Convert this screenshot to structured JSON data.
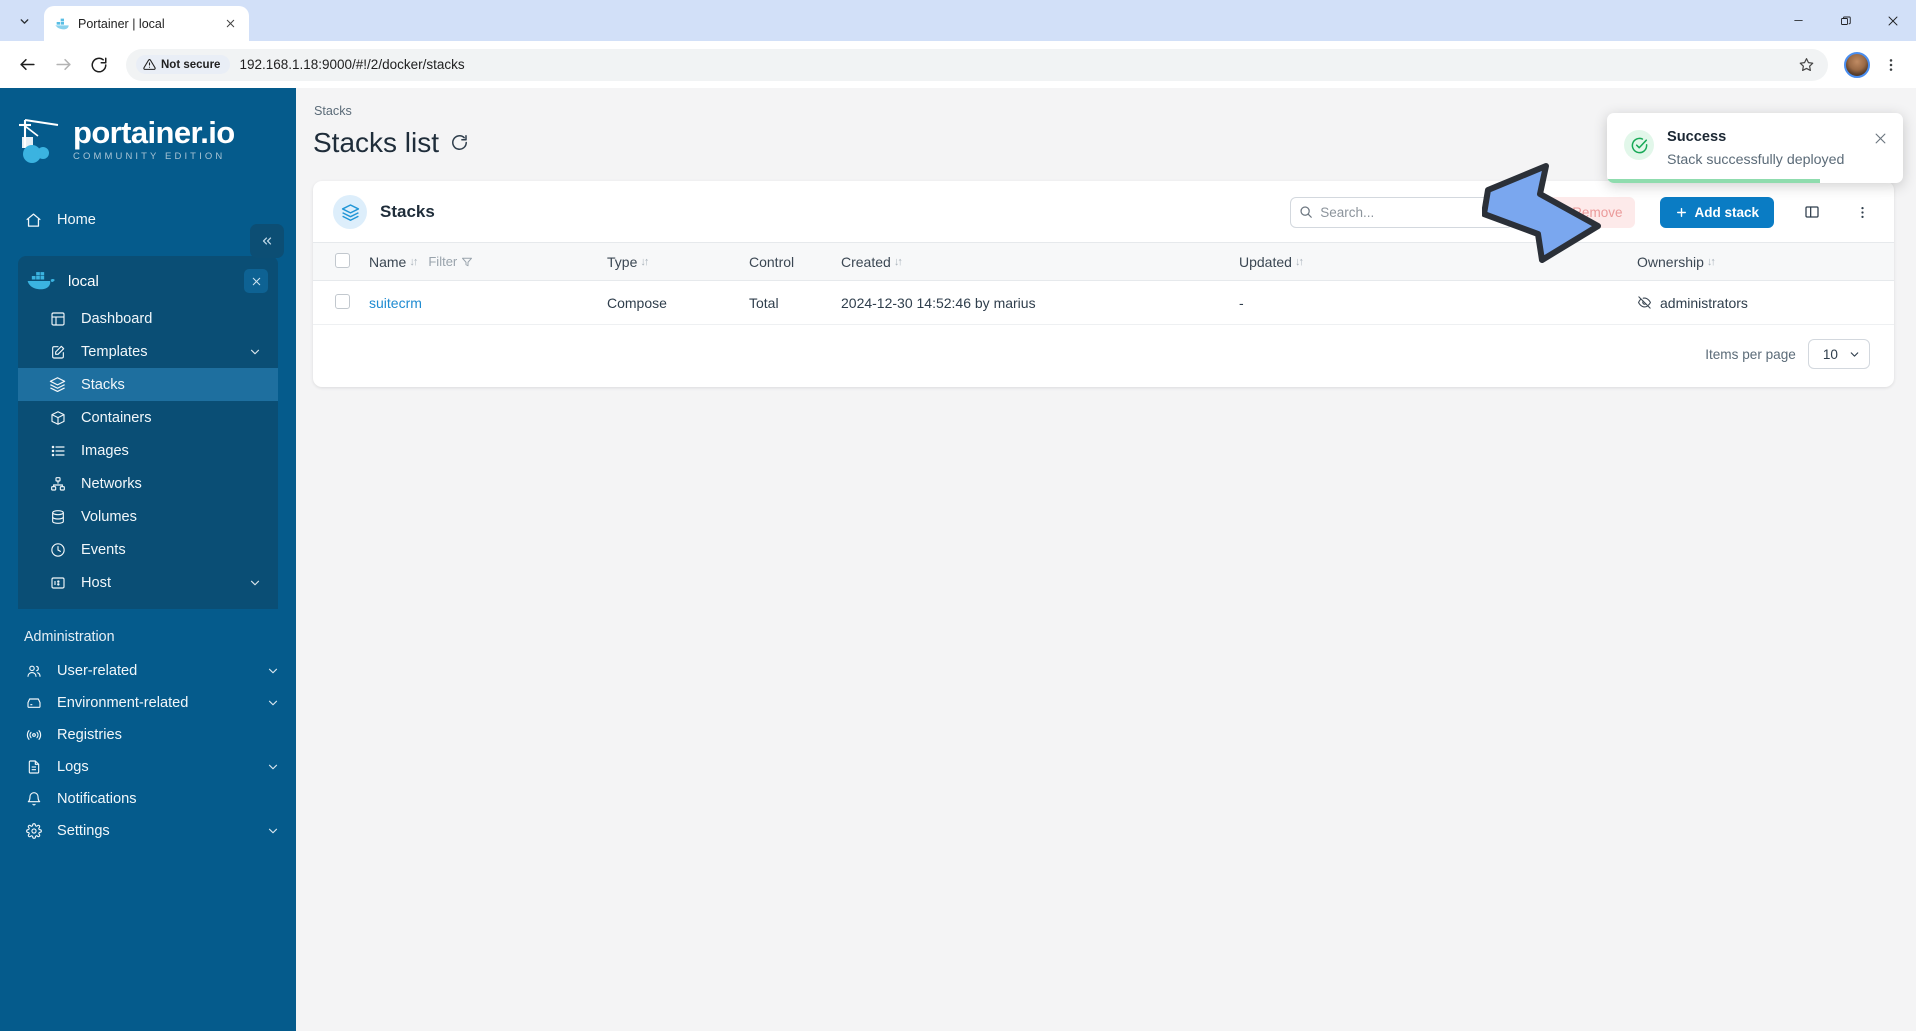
{
  "browser": {
    "tab": {
      "title": "Portainer | local",
      "favicon_icon": "portainer-favicon",
      "close_icon": "close-icon"
    },
    "tab_list_icon": "chevron-down-icon",
    "window_controls": {
      "minimize_icon": "minimize-icon",
      "maximize_icon": "restore-icon",
      "close_icon": "close-icon"
    },
    "nav": {
      "back_icon": "arrow-left-icon",
      "forward_icon": "arrow-right-icon",
      "reload_icon": "reload-icon"
    },
    "omnibox": {
      "security_icon": "warning-triangle-icon",
      "security_label": "Not secure",
      "url": "192.168.1.18:9000/#!/2/docker/stacks",
      "star_icon": "star-icon"
    },
    "profile_icon": "avatar",
    "menu_icon": "kebab-menu-icon"
  },
  "sidebar": {
    "logo": {
      "word": "portainer.io",
      "subtitle": "COMMUNITY EDITION",
      "icon": "portainer-logo-icon"
    },
    "collapse_icon": "chevron-double-left-icon",
    "home": {
      "label": "Home",
      "icon": "home-icon"
    },
    "environment": {
      "name": "local",
      "icon": "docker-whale-icon",
      "close_icon": "close-icon"
    },
    "env_items": [
      {
        "label": "Dashboard",
        "icon": "dashboard-icon",
        "active": false,
        "expandable": false
      },
      {
        "label": "Templates",
        "icon": "template-icon",
        "active": false,
        "expandable": true
      },
      {
        "label": "Stacks",
        "icon": "stacks-icon",
        "active": true,
        "expandable": false
      },
      {
        "label": "Containers",
        "icon": "container-icon",
        "active": false,
        "expandable": false
      },
      {
        "label": "Images",
        "icon": "images-icon",
        "active": false,
        "expandable": false
      },
      {
        "label": "Networks",
        "icon": "networks-icon",
        "active": false,
        "expandable": false
      },
      {
        "label": "Volumes",
        "icon": "volumes-icon",
        "active": false,
        "expandable": false
      },
      {
        "label": "Events",
        "icon": "events-clock-icon",
        "active": false,
        "expandable": false
      },
      {
        "label": "Host",
        "icon": "host-icon",
        "active": false,
        "expandable": true
      }
    ],
    "admin_label": "Administration",
    "admin_items": [
      {
        "label": "User-related",
        "icon": "users-icon",
        "expandable": true
      },
      {
        "label": "Environment-related",
        "icon": "environment-icon",
        "expandable": true
      },
      {
        "label": "Registries",
        "icon": "registries-icon",
        "expandable": false
      },
      {
        "label": "Logs",
        "icon": "logs-icon",
        "expandable": true
      },
      {
        "label": "Notifications",
        "icon": "bell-icon",
        "expandable": false
      },
      {
        "label": "Settings",
        "icon": "gear-icon",
        "expandable": true
      }
    ]
  },
  "main": {
    "breadcrumb": "Stacks",
    "page_title": "Stacks list",
    "refresh_icon": "refresh-icon",
    "card": {
      "title": "Stacks",
      "icon": "stacks-icon",
      "search": {
        "placeholder": "Search...",
        "value": "",
        "search_icon": "search-icon",
        "clear_icon": "close-icon"
      },
      "remove_button": {
        "label": "Remove",
        "icon": "trash-icon",
        "disabled": true
      },
      "add_button": {
        "label": "Add stack",
        "icon": "plus-icon"
      },
      "columns_icon": "columns-layout-icon",
      "overflow_icon": "kebab-menu-icon"
    },
    "table": {
      "select_all_checkbox": "checkbox",
      "columns": [
        {
          "label": "Name",
          "sortable": true
        },
        {
          "label": "Type",
          "sortable": true
        },
        {
          "label": "Control",
          "sortable": false
        },
        {
          "label": "Created",
          "sortable": true
        },
        {
          "label": "Updated",
          "sortable": true
        },
        {
          "label": "Ownership",
          "sortable": true
        }
      ],
      "filter_label": "Filter",
      "filter_icon": "funnel-icon",
      "sort_icon": "sort-arrows-icon",
      "rows": [
        {
          "name": "suitecrm",
          "type": "Compose",
          "control": "Total",
          "created": "2024-12-30 14:52:46 by marius",
          "updated": "-",
          "ownership": "administrators",
          "ownership_icon": "eye-off-icon"
        }
      ]
    },
    "pagination": {
      "label": "Items per page",
      "value": "10",
      "chevron_icon": "chevron-down-icon"
    }
  },
  "toast": {
    "title": "Success",
    "message": "Stack successfully deployed",
    "icon": "check-circle-icon",
    "close_icon": "close-icon",
    "accent_color": "#8fdcae"
  },
  "annotation": {
    "arrow_icon": "arrow-pointer-annotation",
    "color": "#7aa7ef"
  }
}
